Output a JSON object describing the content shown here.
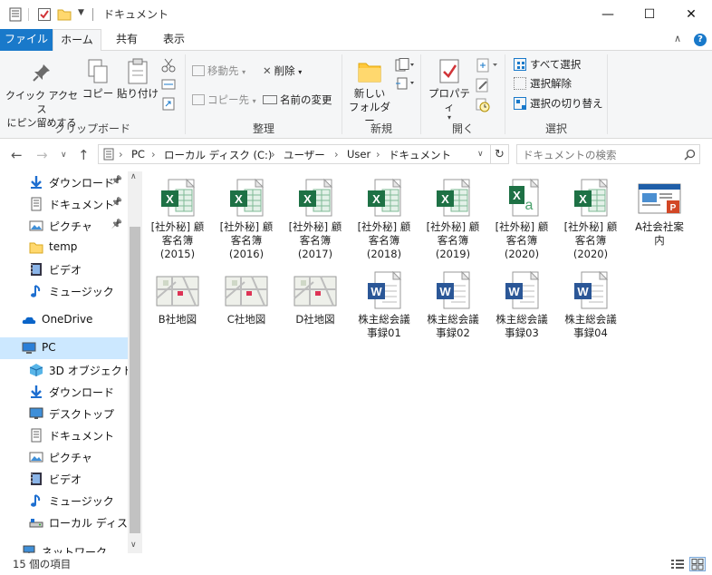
{
  "window": {
    "title": "ドキュメント",
    "minimize_glyph": "—",
    "maximize_glyph": "☐",
    "close_glyph": "✕"
  },
  "ribbon_tabs": [
    {
      "label": "ファイル"
    },
    {
      "label": "ホーム"
    },
    {
      "label": "共有"
    },
    {
      "label": "表示"
    }
  ],
  "ribbon": {
    "clipboard": {
      "pin_label": "クイック アクセス\nにピン留めする",
      "copy_label": "コピー",
      "paste_label": "貼り付け",
      "group_label": "クリップボード"
    },
    "organize": {
      "move_label": "移動先",
      "copy_to_label": "コピー先",
      "delete_label": "削除",
      "rename_label": "名前の変更",
      "group_label": "整理"
    },
    "new": {
      "new_folder_label": "新しい\nフォルダー",
      "group_label": "新規"
    },
    "open": {
      "properties_label": "プロパティ",
      "group_label": "開く"
    },
    "select": {
      "select_all_label": "すべて選択",
      "select_none_label": "選択解除",
      "invert_label": "選択の切り替え",
      "group_label": "選択"
    }
  },
  "address": {
    "crumbs": [
      "PC",
      "ローカル ディスク (C:)",
      "ユーザー",
      "User",
      "ドキュメント"
    ],
    "search_placeholder": "ドキュメントの検索"
  },
  "nav_pane": {
    "items": [
      {
        "label": "ダウンロード",
        "icon": "download-icon",
        "pinned": true
      },
      {
        "label": "ドキュメント",
        "icon": "document-icon",
        "pinned": true
      },
      {
        "label": "ピクチャ",
        "icon": "pictures-icon",
        "pinned": true
      },
      {
        "label": "temp",
        "icon": "folder-icon",
        "pinned": false
      },
      {
        "label": "ビデオ",
        "icon": "video-icon",
        "pinned": false
      },
      {
        "label": "ミュージック",
        "icon": "music-icon",
        "pinned": false
      },
      {
        "label": "OneDrive",
        "icon": "onedrive-icon",
        "pinned": false
      },
      {
        "label": "PC",
        "icon": "pc-icon",
        "pinned": false,
        "selected": true
      },
      {
        "label": "3D オブジェクト",
        "icon": "3d-objects-icon",
        "pinned": false
      },
      {
        "label": "ダウンロード",
        "icon": "download-icon",
        "pinned": false
      },
      {
        "label": "デスクトップ",
        "icon": "desktop-icon",
        "pinned": false
      },
      {
        "label": "ドキュメント",
        "icon": "document-icon",
        "pinned": false
      },
      {
        "label": "ピクチャ",
        "icon": "pictures-icon",
        "pinned": false
      },
      {
        "label": "ビデオ",
        "icon": "video-icon",
        "pinned": false
      },
      {
        "label": "ミュージック",
        "icon": "music-icon",
        "pinned": false
      },
      {
        "label": "ローカル ディスク (C",
        "icon": "drive-icon",
        "pinned": false
      },
      {
        "label": "ネットワーク",
        "icon": "network-icon",
        "pinned": false
      }
    ]
  },
  "files": [
    {
      "name": "[社外秘] 顧客名簿 (2015)",
      "line1": "[社外秘] 顧",
      "line2": "客名簿",
      "line3": "(2015)",
      "type": "excel-icon"
    },
    {
      "name": "[社外秘] 顧客名簿 (2016)",
      "line1": "[社外秘] 顧",
      "line2": "客名簿",
      "line3": "(2016)",
      "type": "excel-icon"
    },
    {
      "name": "[社外秘] 顧客名簿 (2017)",
      "line1": "[社外秘] 顧",
      "line2": "客名簿",
      "line3": "(2017)",
      "type": "excel-icon"
    },
    {
      "name": "[社外秘] 顧客名簿 (2018)",
      "line1": "[社外秘] 顧",
      "line2": "客名簿",
      "line3": "(2018)",
      "type": "excel-icon"
    },
    {
      "name": "[社外秘] 顧客名簿 (2019)",
      "line1": "[社外秘] 顧",
      "line2": "客名簿",
      "line3": "(2019)",
      "type": "excel-icon"
    },
    {
      "name": "[社外秘] 顧客名簿 (2020)",
      "line1": "[社外秘] 顧",
      "line2": "客名簿",
      "line3": "(2020)",
      "type": "excel-csv-icon"
    },
    {
      "name": "[社外秘] 顧客名簿 (2020)",
      "line1": "[社外秘] 顧",
      "line2": "客名簿",
      "line3": "(2020)",
      "type": "excel-icon"
    },
    {
      "name": "A社会社案内",
      "line1": "A社会社案",
      "line2": "内",
      "line3": "",
      "type": "powerpoint-icon"
    },
    {
      "name": "B社地図",
      "line1": "B社地図",
      "line2": "",
      "line3": "",
      "type": "map-image-icon"
    },
    {
      "name": "C社地図",
      "line1": "C社地図",
      "line2": "",
      "line3": "",
      "type": "map-image-icon"
    },
    {
      "name": "D社地図",
      "line1": "D社地図",
      "line2": "",
      "line3": "",
      "type": "map-image-icon"
    },
    {
      "name": "株主総会議事録01",
      "line1": "株主総会議",
      "line2": "事録01",
      "line3": "",
      "type": "word-icon"
    },
    {
      "name": "株主総会議事録02",
      "line1": "株主総会議",
      "line2": "事録02",
      "line3": "",
      "type": "word-icon"
    },
    {
      "name": "株主総会議事録03",
      "line1": "株主総会議",
      "line2": "事録03",
      "line3": "",
      "type": "word-icon"
    },
    {
      "name": "株主総会議事録04",
      "line1": "株主総会議",
      "line2": "事録04",
      "line3": "",
      "type": "word-icon"
    }
  ],
  "status": {
    "item_count": "15 個の項目"
  },
  "colors": {
    "file_tab": "#1979ca",
    "selected_bg": "#cce8ff",
    "excel_green": "#1e7145",
    "word_blue": "#2b5797",
    "ppt_orange": "#d24726"
  }
}
